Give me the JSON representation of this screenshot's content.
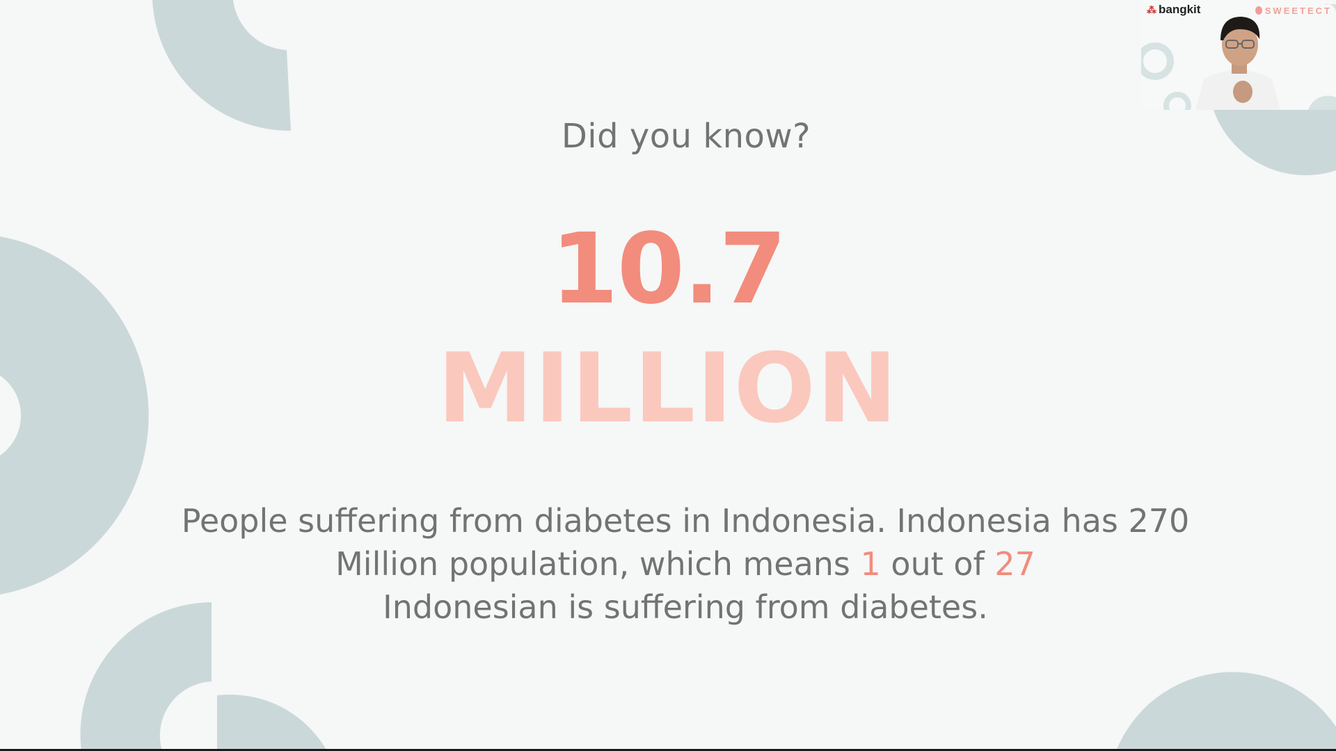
{
  "slide": {
    "heading": "Did you know?",
    "big_number": "10.7",
    "big_unit": "MILLION",
    "body": {
      "part1": "People suffering from diabetes in Indonesia. Indonesia has 270 Million population, which means ",
      "highlight1": "1",
      "part2": " out of ",
      "highlight2": "27",
      "part3": " Indonesian is suffering from diabetes."
    }
  },
  "webcam": {
    "logo_left": "bangkit",
    "logo_right": "SWEETECT"
  },
  "colors": {
    "background": "#f6f7f7",
    "decor": "#cbd8d9",
    "accent": "#f28c7d",
    "accent_light": "#fbc8bd",
    "text": "#737373"
  },
  "icons": {
    "webcam_person": "person-on-video",
    "bangkit_logo": "bangkit-logo-icon",
    "sweetect_logo": "sweetect-logo-icon"
  }
}
